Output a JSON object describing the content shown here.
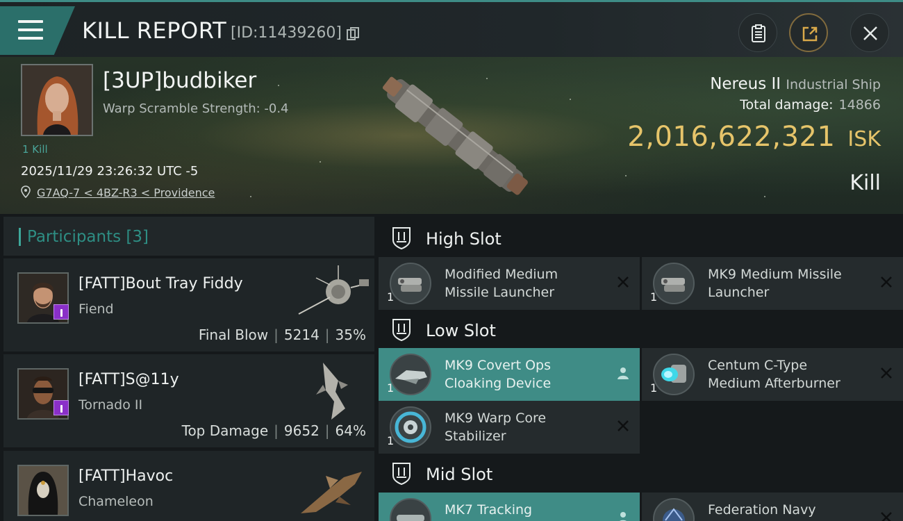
{
  "header": {
    "title": "KILL REPORT",
    "report_id": "[ID:11439260]"
  },
  "victim": {
    "name": "[3UP]budbiker",
    "warp_scramble": "Warp Scramble Strength: -0.4",
    "kills": "1 Kill",
    "timestamp": "2025/11/29 23:26:32 UTC -5",
    "location": "G7AQ-7 < 4BZ-R3 < Providence",
    "ship_name": "Nereus II",
    "ship_class": "Industrial Ship",
    "total_damage_label": "Total damage:",
    "total_damage": "14866",
    "isk_value": "2,016,622,321",
    "isk_unit": "ISK",
    "result": "Kill"
  },
  "participants": {
    "label": "Participants",
    "count": "[3]",
    "items": [
      {
        "name": "[FATT]Bout Tray Fiddy",
        "ship": "Fiend",
        "role": "Final Blow",
        "damage": "5214",
        "percent": "35%"
      },
      {
        "name": "[FATT]S@11y",
        "ship": "Tornado II",
        "role": "Top Damage",
        "damage": "9652",
        "percent": "64%"
      },
      {
        "name": "[FATT]Havoc",
        "ship": "Chameleon"
      }
    ]
  },
  "slots": {
    "high": {
      "label": "High Slot",
      "modules": [
        {
          "qty": "1",
          "line1": "Modified Medium",
          "line2": "Missile Launcher",
          "status": "destroyed"
        },
        {
          "qty": "1",
          "line1": "MK9 Medium Missile",
          "line2": "Launcher",
          "status": "destroyed"
        }
      ]
    },
    "low": {
      "label": "Low Slot",
      "modules": [
        {
          "qty": "1",
          "line1": "MK9 Covert Ops",
          "line2": "Cloaking Device",
          "status": "dropped"
        },
        {
          "qty": "1",
          "line1": "Centum C-Type",
          "line2": "Medium Afterburner",
          "status": "destroyed"
        },
        {
          "qty": "1",
          "line1": "MK9 Warp Core",
          "line2": "Stabilizer",
          "status": "destroyed"
        }
      ]
    },
    "mid": {
      "label": "Mid Slot",
      "modules": [
        {
          "line1": "MK7 Tracking",
          "status": "dropped"
        },
        {
          "line1": "Federation Navy",
          "status": "destroyed"
        }
      ]
    }
  },
  "colors": {
    "accent": "#3f8c86",
    "isk_gold": "#e6c46a",
    "badge_purple": "#8a2fc8"
  }
}
